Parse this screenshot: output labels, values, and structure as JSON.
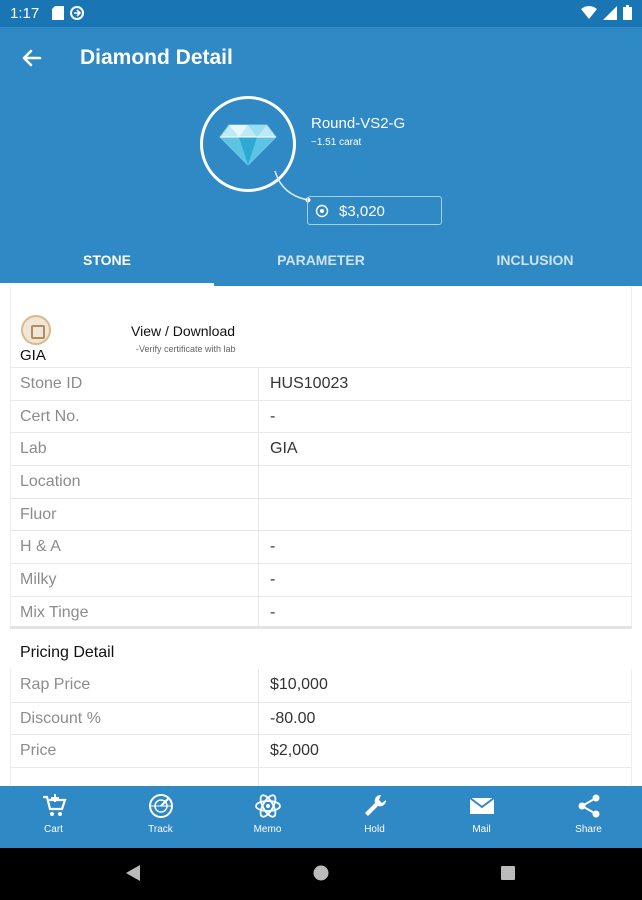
{
  "status_bar": {
    "time": "1:17"
  },
  "app_bar": {
    "title": "Diamond Detail"
  },
  "hero": {
    "stone_name": "Round-VS2-G",
    "carat": "~1.51 carat",
    "price": "$3,020"
  },
  "tabs": [
    {
      "label": "STONE",
      "active": true
    },
    {
      "label": "PARAMETER",
      "active": false
    },
    {
      "label": "INCLUSION",
      "active": false
    }
  ],
  "certificate": {
    "lab": "GIA",
    "link": "View / Download",
    "hint": "-Verify certificate with lab"
  },
  "details": [
    {
      "label": "Stone ID",
      "value": "HUS10023"
    },
    {
      "label": "Cert No.",
      "value": "-"
    },
    {
      "label": "Lab",
      "value": "GIA"
    },
    {
      "label": "Location",
      "value": ""
    },
    {
      "label": "Fluor",
      "value": ""
    },
    {
      "label": "H & A",
      "value": "-"
    },
    {
      "label": "Milky",
      "value": "-"
    },
    {
      "label": "Mix Tinge",
      "value": "-"
    }
  ],
  "pricing": {
    "title": "Pricing Detail",
    "rows": [
      {
        "label": "Rap Price",
        "value": "$10,000"
      },
      {
        "label": "Discount %",
        "value": "-80.00"
      },
      {
        "label": "Price",
        "value": "$2,000"
      }
    ]
  },
  "bottom_nav": [
    {
      "label": "Cart",
      "icon": "cart-icon"
    },
    {
      "label": "Track",
      "icon": "radar-icon"
    },
    {
      "label": "Memo",
      "icon": "atom-icon"
    },
    {
      "label": "Hold",
      "icon": "wrench-icon"
    },
    {
      "label": "Mail",
      "icon": "mail-icon"
    },
    {
      "label": "Share",
      "icon": "share-icon"
    }
  ],
  "colors": {
    "primary": "#2e89c5",
    "status_bar": "#1a75b5"
  }
}
